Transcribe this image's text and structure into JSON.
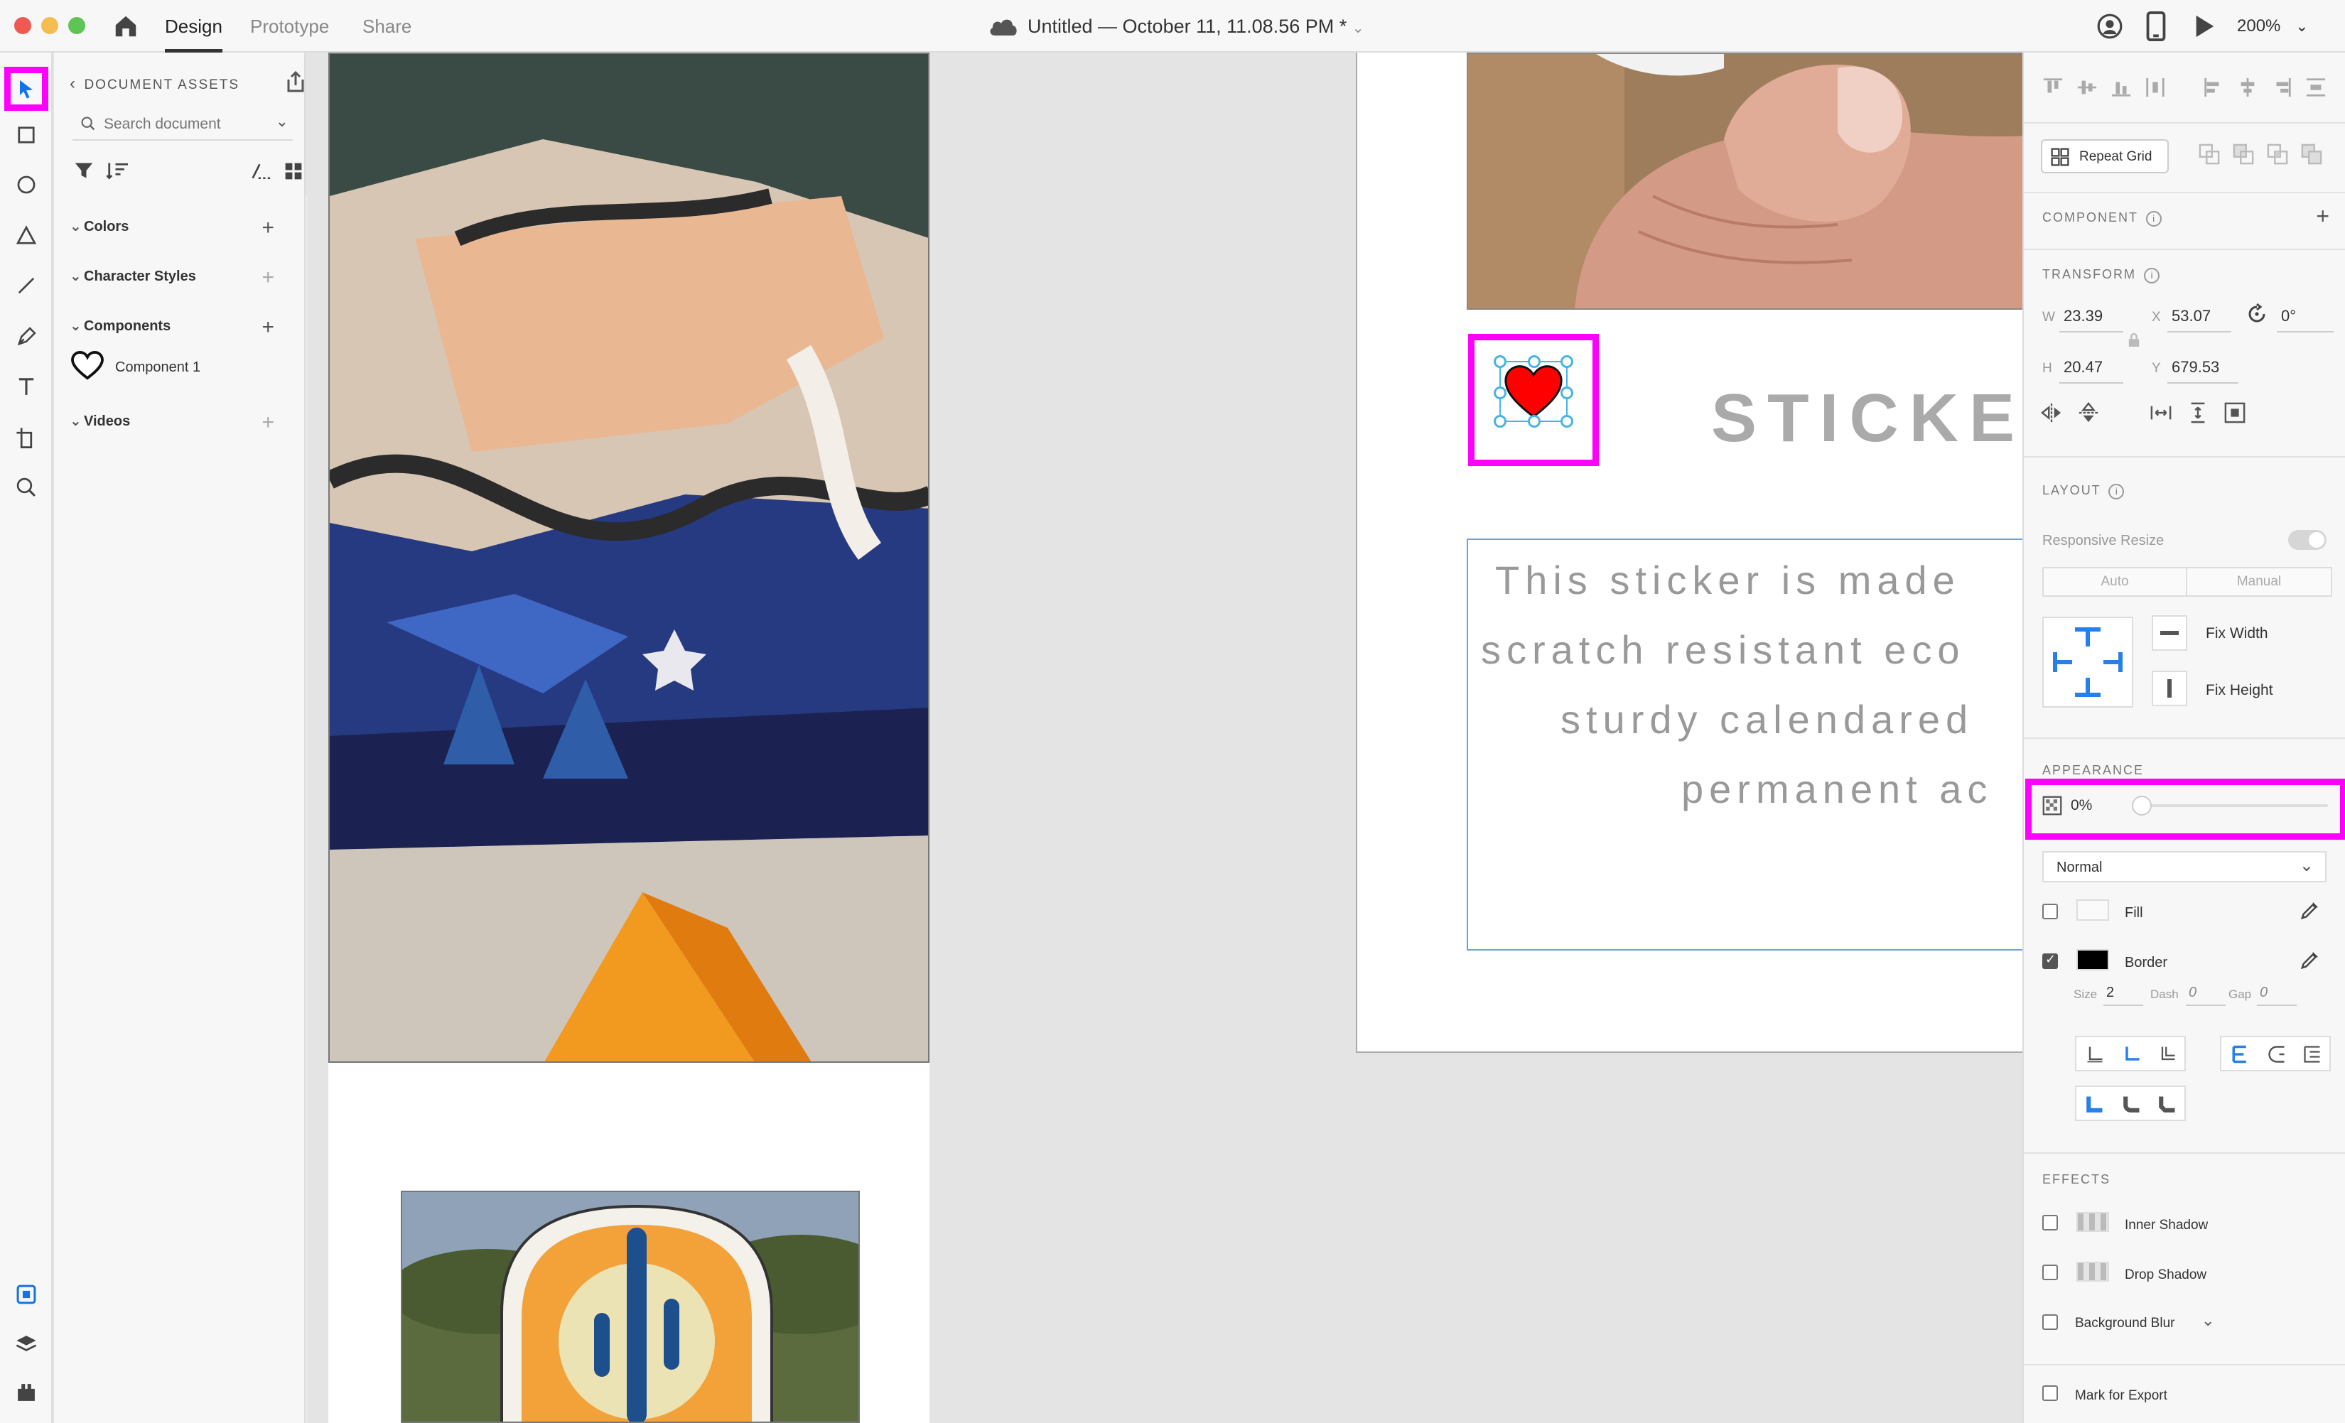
{
  "titlebar": {
    "tabs": [
      {
        "label": "Design",
        "active": true
      },
      {
        "label": "Prototype",
        "active": false
      },
      {
        "label": "Share",
        "active": false
      }
    ],
    "doc_title": "Untitled — October 11, 11.08.56 PM *",
    "zoom": "200%"
  },
  "assets": {
    "header": "DOCUMENT ASSETS",
    "search_placeholder": "Search document",
    "sections": {
      "colors": "Colors",
      "character_styles": "Character Styles",
      "components": "Components",
      "videos": "Videos"
    },
    "component_item": "Component 1"
  },
  "canvas": {
    "heading": "STICKE",
    "body_lines": [
      "This sticker is made",
      "scratch resistant eco",
      "sturdy calendared",
      "permanent ac"
    ]
  },
  "inspector": {
    "repeat_grid": "Repeat Grid",
    "component_label": "COMPONENT",
    "transform_label": "TRANSFORM",
    "w_label": "W",
    "w_value": "23.39",
    "x_label": "X",
    "x_value": "53.07",
    "rotation": "0°",
    "h_label": "H",
    "h_value": "20.47",
    "y_label": "Y",
    "y_value": "679.53",
    "layout_label": "LAYOUT",
    "responsive_resize": "Responsive Resize",
    "auto": "Auto",
    "manual": "Manual",
    "fix_width": "Fix Width",
    "fix_height": "Fix Height",
    "appearance_label": "APPEARANCE",
    "opacity": "0%",
    "blend_mode": "Normal",
    "fill": "Fill",
    "border": "Border",
    "size_label": "Size",
    "size_value": "2",
    "dash_label": "Dash",
    "dash_value": "0",
    "gap_label": "Gap",
    "gap_value": "0",
    "effects_label": "EFFECTS",
    "inner_shadow": "Inner Shadow",
    "drop_shadow": "Drop Shadow",
    "background_blur": "Background Blur",
    "mark_for_export": "Mark for Export"
  },
  "colors": {
    "highlight": "#ff00ff",
    "accent": "#2680eb",
    "heart": "#ff0000"
  }
}
